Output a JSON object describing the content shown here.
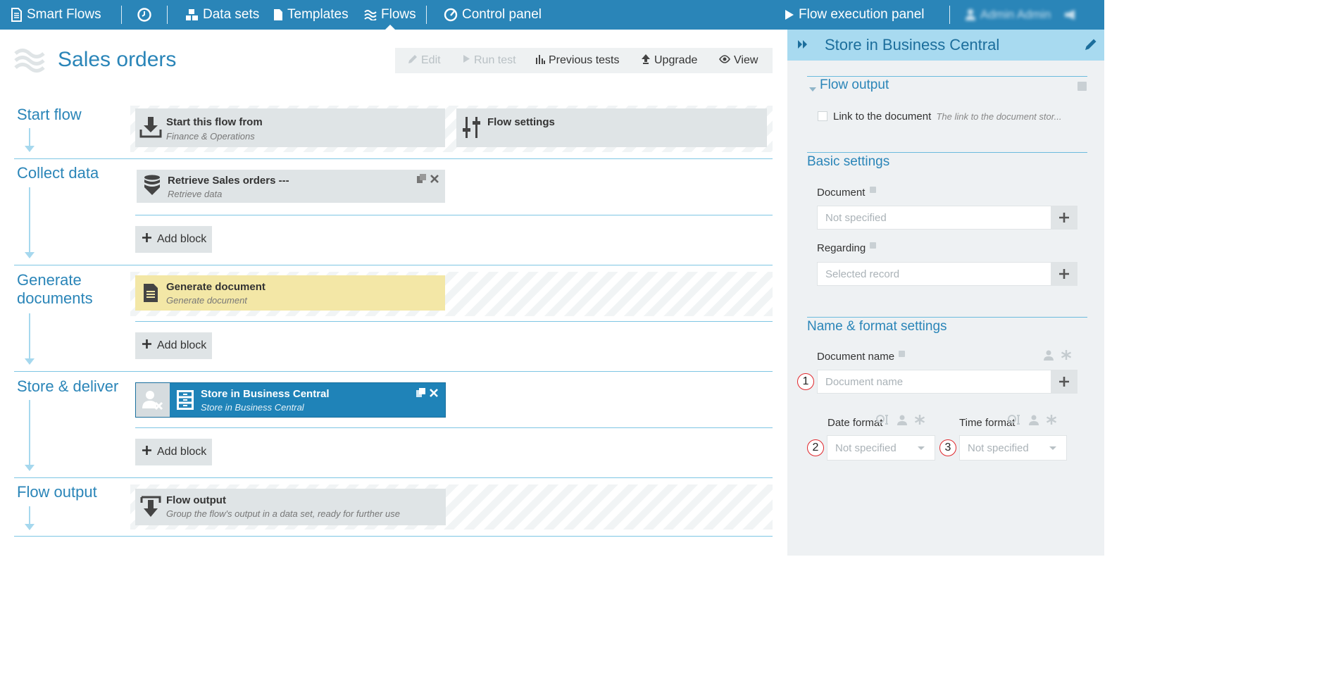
{
  "nav": {
    "brand": "Smart Flows",
    "data_sets": "Data sets",
    "templates": "Templates",
    "flows": "Flows",
    "control_panel": "Control panel",
    "flow_exec": "Flow execution panel",
    "user": "Admin Admin"
  },
  "page": {
    "title": "Sales orders",
    "toolbar": {
      "edit": "Edit",
      "run_test": "Run test",
      "previous_tests": "Previous tests",
      "upgrade": "Upgrade",
      "view": "View"
    }
  },
  "sections": [
    {
      "label": "Start flow"
    },
    {
      "label": "Collect data"
    },
    {
      "label": "Generate documents"
    },
    {
      "label": "Store & deliver"
    },
    {
      "label": "Flow output"
    }
  ],
  "blocks": {
    "start_from": {
      "title": "Start this flow from",
      "subtitle": "Finance & Operations"
    },
    "flow_settings": {
      "title": "Flow settings"
    },
    "retrieve": {
      "title": "Retrieve Sales orders ---",
      "subtitle": "Retrieve data"
    },
    "generate": {
      "title": "Generate document",
      "subtitle": "Generate document"
    },
    "store": {
      "title": "Store in Business Central",
      "subtitle": "Store in Business Central"
    },
    "flow_output": {
      "title": "Flow output",
      "subtitle": "Group the flow's output in a data set, ready for further use"
    }
  },
  "add_block_label": "Add block",
  "panel": {
    "title": "Store in Business Central",
    "flow_output": {
      "heading": "Flow output",
      "checkbox_label": "Link to the document",
      "checkbox_desc": "The link to the document stor...",
      "checked": false
    },
    "basic": {
      "heading": "Basic settings",
      "document_label": "Document",
      "document_placeholder": "Not specified",
      "regarding_label": "Regarding",
      "regarding_placeholder": "Selected record"
    },
    "name_format": {
      "heading": "Name & format settings",
      "doc_name_label": "Document name",
      "doc_name_placeholder": "Document name",
      "date_format_label": "Date format",
      "date_format_value": "Not specified",
      "time_format_label": "Time format",
      "time_format_value": "Not specified"
    },
    "markers": [
      "1",
      "2",
      "3"
    ]
  },
  "colors": {
    "topbar": "#2a85b8",
    "panel_header": "#a8daf0",
    "accent": "#2a85b8",
    "store_block": "#1f83b8",
    "generate_block": "#f3e7a6"
  }
}
